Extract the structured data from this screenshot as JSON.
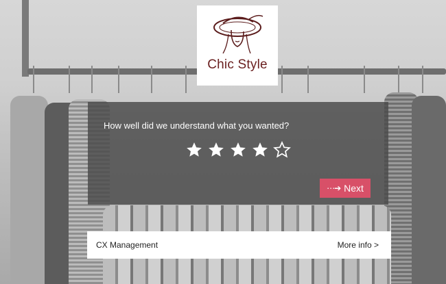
{
  "logo": {
    "text": "Chic Style",
    "icon": "woman-hat-icon",
    "brand_color": "#6b2020"
  },
  "survey": {
    "question": "How well did we understand what you wanted?",
    "rating": {
      "value": 4,
      "max": 5
    },
    "next_label": "Next",
    "next_icon": "dotted-arrow-icon",
    "button_color": "#d85068"
  },
  "footer": {
    "brand": "CX Management",
    "more_label": "More info >"
  }
}
